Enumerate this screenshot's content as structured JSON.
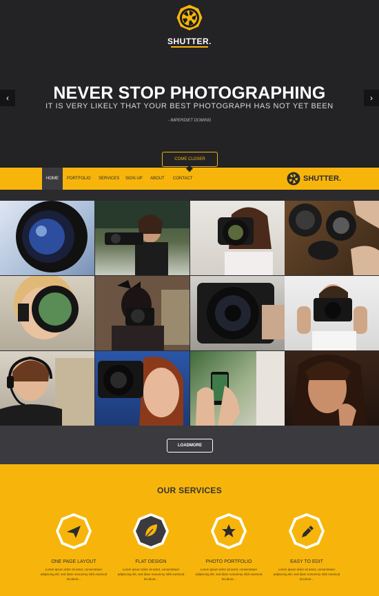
{
  "hero": {
    "brand": "SHUTTER.",
    "title": "NEVER STOP PHOTOGRAPHING",
    "subtitle": "IT IS VERY LIKELY THAT YOUR BEST PHOTOGRAPH HAS NOT YET BEEN",
    "quote": "- IMPERDIET DOMING",
    "cta": "COME CLOSER",
    "prev_icon": "chevron-left-icon",
    "next_icon": "chevron-right-icon"
  },
  "nav": {
    "items": [
      {
        "label": "HOME",
        "active": true
      },
      {
        "label": "PORTFOLIO",
        "active": false
      },
      {
        "label": "SERVICES",
        "active": false
      },
      {
        "label": "SIGN UP",
        "active": false
      },
      {
        "label": "ABOUT",
        "active": false
      },
      {
        "label": "CONTACT",
        "active": false
      }
    ],
    "brand": "SHUTTER."
  },
  "gallery": {
    "loadmore": "LOADMORE"
  },
  "services": {
    "title": "OUR SERVICES",
    "items": [
      {
        "title": "ONE PAGE LAYOUT",
        "icon": "paper-plane-icon",
        "text": "Lorem ipsum dolor sit amet, consectetuer adipiscing elit, sed diam nonummy nibh euismod tincidunt..."
      },
      {
        "title": "FLAT DESIGN",
        "icon": "leaf-icon",
        "text": "Lorem ipsum dolor sit amet, consectetuer adipiscing elit, sed diam nonummy nibh euismod tincidunt..."
      },
      {
        "title": "PHOTO PORTFOLIO",
        "icon": "star-icon",
        "text": "Lorem ipsum dolor sit amet, consectetuer adipiscing elit, sed diam nonummy nibh euismod tincidunt..."
      },
      {
        "title": "EASY TO EDIT",
        "icon": "pencil-icon",
        "text": "Lorem ipsum dolor sit amet, consectetuer adipiscing elit, sed diam nonummy nibh euismod tincidunt..."
      }
    ]
  },
  "colors": {
    "accent": "#f7b50b",
    "dark": "#232325",
    "band": "#3b3b3f"
  }
}
